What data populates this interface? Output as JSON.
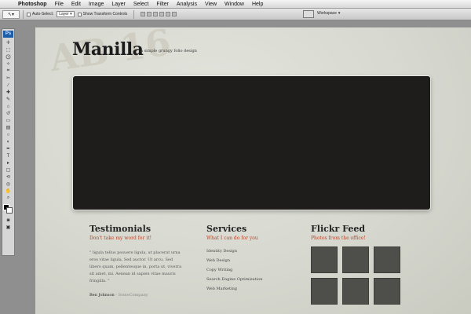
{
  "menubar": {
    "apple_glyph": "",
    "app": "Photoshop",
    "items": [
      "File",
      "Edit",
      "Image",
      "Layer",
      "Select",
      "Filter",
      "Analysis",
      "View",
      "Window",
      "Help"
    ]
  },
  "options": {
    "auto_select": "Auto-Select:",
    "layer_select": "Layer",
    "show_transform": "Show Transform Controls",
    "workspace": "Workspace"
  },
  "tools": {
    "logo": "Ps"
  },
  "page": {
    "logo": "Manilla",
    "tagline": "a simple grungy folio design",
    "watermark": "AB 16",
    "testimonials": {
      "title": "Testimonials",
      "subtitle": "Don't take my word for it!",
      "quote": "\" ligula tellus posuere ligula, ut placerat urna eros vitae ligula. Sed auctor. Ut arcu. Sed libero quam, pellentesque in, porta ut, viverra sit amet, mi. Aenean id sapien vitae mauris fringilla. \"",
      "author": "Ben Johnson",
      "company": "- SomeCompany"
    },
    "services": {
      "title": "Services",
      "subtitle": "What I can do for you",
      "items": [
        "Identity Design",
        "Web Design",
        "Copy Writing",
        "Search Engine Optimization",
        "Web Marketing"
      ]
    },
    "flickr": {
      "title": "Flickr Feed",
      "subtitle": "Photos from the office!"
    }
  }
}
